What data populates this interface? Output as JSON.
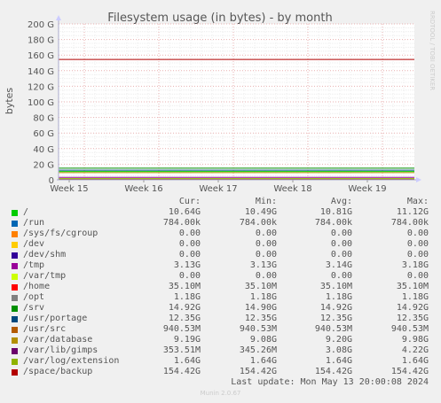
{
  "chart_data": {
    "type": "line",
    "title": "Filesystem usage (in bytes) - by month",
    "ylabel": "bytes",
    "xlabel": "",
    "side_label": "RRDTOOL / TOBI OETIKER",
    "ylim": [
      0,
      200
    ],
    "yticks": [
      "0",
      "20 G",
      "40 G",
      "60 G",
      "80 G",
      "100 G",
      "120 G",
      "140 G",
      "160 G",
      "180 G",
      "200 G"
    ],
    "xticks": [
      "Week 15",
      "Week 16",
      "Week 17",
      "Week 18",
      "Week 19"
    ],
    "grid": true,
    "series": [
      {
        "name": "/",
        "color": "#00cc00",
        "value": 10.64
      },
      {
        "name": "/run",
        "color": "#0066b3",
        "value": 0.000784
      },
      {
        "name": "/sys/fs/cgroup",
        "color": "#ff8000",
        "value": 0
      },
      {
        "name": "/dev",
        "color": "#ffcc00",
        "value": 0
      },
      {
        "name": "/dev/shm",
        "color": "#330099",
        "value": 0
      },
      {
        "name": "/tmp",
        "color": "#990099",
        "value": 3.13
      },
      {
        "name": "/var/tmp",
        "color": "#ccff00",
        "value": 0
      },
      {
        "name": "/home",
        "color": "#ff0000",
        "value": 0.0351
      },
      {
        "name": "/opt",
        "color": "#808080",
        "value": 1.18
      },
      {
        "name": "/srv",
        "color": "#008f00",
        "value": 14.92
      },
      {
        "name": "/usr/portage",
        "color": "#00487d",
        "value": 12.35
      },
      {
        "name": "/usr/src",
        "color": "#b35a00",
        "value": 0.9405
      },
      {
        "name": "/var/database",
        "color": "#b38f00",
        "value": 9.19
      },
      {
        "name": "/var/lib/gimps",
        "color": "#6b006b",
        "value": 0.3535
      },
      {
        "name": "/var/log/extension",
        "color": "#8fb300",
        "value": 1.64
      },
      {
        "name": "/space/backup",
        "color": "#b30000",
        "value": 154.42
      }
    ]
  },
  "legend": {
    "headers": {
      "cur": "Cur:",
      "min": "Min:",
      "avg": "Avg:",
      "max": "Max:"
    },
    "rows": [
      {
        "name": "/",
        "color": "#00cc00",
        "cur": "10.64G",
        "min": "10.49G",
        "avg": "10.81G",
        "max": "11.12G"
      },
      {
        "name": "/run",
        "color": "#0066b3",
        "cur": "784.00k",
        "min": "784.00k",
        "avg": "784.00k",
        "max": "784.00k"
      },
      {
        "name": "/sys/fs/cgroup",
        "color": "#ff8000",
        "cur": "0.00",
        "min": "0.00",
        "avg": "0.00",
        "max": "0.00"
      },
      {
        "name": "/dev",
        "color": "#ffcc00",
        "cur": "0.00",
        "min": "0.00",
        "avg": "0.00",
        "max": "0.00"
      },
      {
        "name": "/dev/shm",
        "color": "#330099",
        "cur": "0.00",
        "min": "0.00",
        "avg": "0.00",
        "max": "0.00"
      },
      {
        "name": "/tmp",
        "color": "#990099",
        "cur": "3.13G",
        "min": "3.13G",
        "avg": "3.14G",
        "max": "3.18G"
      },
      {
        "name": "/var/tmp",
        "color": "#ccff00",
        "cur": "0.00",
        "min": "0.00",
        "avg": "0.00",
        "max": "0.00"
      },
      {
        "name": "/home",
        "color": "#ff0000",
        "cur": "35.10M",
        "min": "35.10M",
        "avg": "35.10M",
        "max": "35.10M"
      },
      {
        "name": "/opt",
        "color": "#808080",
        "cur": "1.18G",
        "min": "1.18G",
        "avg": "1.18G",
        "max": "1.18G"
      },
      {
        "name": "/srv",
        "color": "#008f00",
        "cur": "14.92G",
        "min": "14.90G",
        "avg": "14.92G",
        "max": "14.92G"
      },
      {
        "name": "/usr/portage",
        "color": "#00487d",
        "cur": "12.35G",
        "min": "12.35G",
        "avg": "12.35G",
        "max": "12.35G"
      },
      {
        "name": "/usr/src",
        "color": "#b35a00",
        "cur": "940.53M",
        "min": "940.53M",
        "avg": "940.53M",
        "max": "940.53M"
      },
      {
        "name": "/var/database",
        "color": "#b38f00",
        "cur": "9.19G",
        "min": "9.08G",
        "avg": "9.20G",
        "max": "9.98G"
      },
      {
        "name": "/var/lib/gimps",
        "color": "#6b006b",
        "cur": "353.51M",
        "min": "345.26M",
        "avg": "3.08G",
        "max": "4.22G"
      },
      {
        "name": "/var/log/extension",
        "color": "#8fb300",
        "cur": "1.64G",
        "min": "1.64G",
        "avg": "1.64G",
        "max": "1.64G"
      },
      {
        "name": "/space/backup",
        "color": "#b30000",
        "cur": "154.42G",
        "min": "154.42G",
        "avg": "154.42G",
        "max": "154.42G"
      }
    ]
  },
  "last_update": "Last update: Mon May 13 20:00:08 2024",
  "footer": "Munin 2.0.67"
}
